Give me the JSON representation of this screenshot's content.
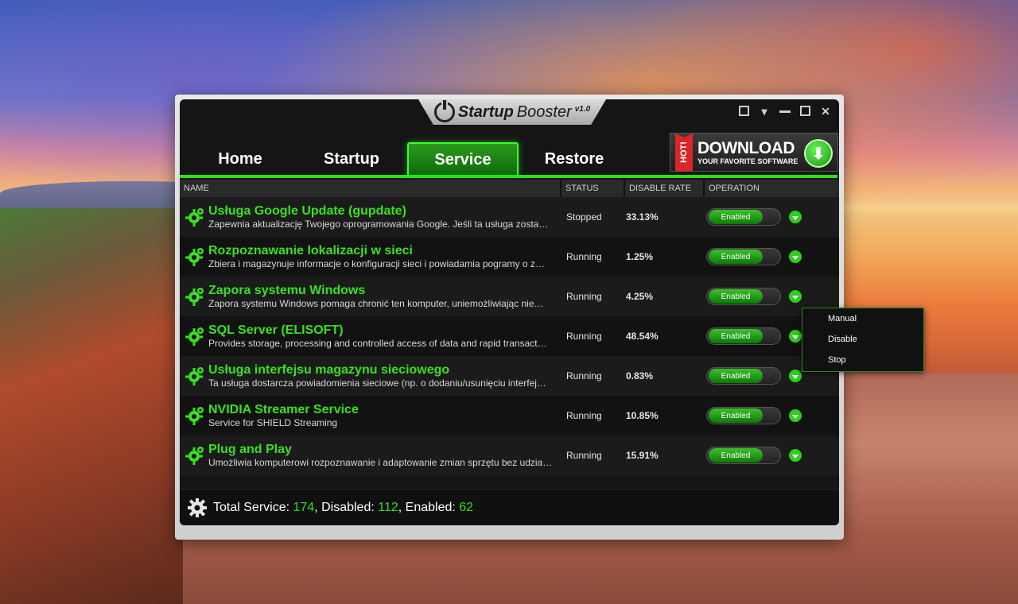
{
  "app": {
    "title_bold": "Startup",
    "title_light": "Booster",
    "version": "v1.0"
  },
  "nav": {
    "tabs": [
      {
        "label": "Home"
      },
      {
        "label": "Startup"
      },
      {
        "label": "Service"
      },
      {
        "label": "Restore"
      }
    ],
    "active": "Service"
  },
  "banner": {
    "hot": "HOT!",
    "main": "DOWNLOAD",
    "sub": "YOUR FAVORITE SOFTWARE"
  },
  "table": {
    "headers": {
      "name": "NAME",
      "status": "STATUS",
      "rate": "DISABLE RATE",
      "operation": "OPERATION"
    },
    "rows": [
      {
        "title": "Usługa Google Update (gupdate)",
        "desc": "Zapewnia aktualizację Twojego oprogramowania Google. Jeśli ta usługa zosta…",
        "status": "Stopped",
        "rate": "33.13%",
        "op": "Enabled"
      },
      {
        "title": "Rozpoznawanie lokalizacji w sieci",
        "desc": "Zbiera i magazynuje informacje o konfiguracji sieci i powiadamia pogramy o z…",
        "status": "Running",
        "rate": "1.25%",
        "op": "Enabled"
      },
      {
        "title": "Zapora systemu Windows",
        "desc": "Zapora systemu Windows pomaga chronić ten komputer, uniemożliwiając nie…",
        "status": "Running",
        "rate": "4.25%",
        "op": "Enabled"
      },
      {
        "title": "SQL Server (ELISOFT)",
        "desc": "Provides storage, processing and controlled access of data and rapid transact…",
        "status": "Running",
        "rate": "48.54%",
        "op": "Enabled"
      },
      {
        "title": "Usługa interfejsu magazynu sieciowego",
        "desc": "Ta usługa dostarcza powiadomienia sieciowe (np. o dodaniu/usunięciu interfej…",
        "status": "Running",
        "rate": "0.83%",
        "op": "Enabled"
      },
      {
        "title": "NVIDIA Streamer Service",
        "desc": "Service for SHIELD Streaming",
        "status": "Running",
        "rate": "10.85%",
        "op": "Enabled"
      },
      {
        "title": "Plug and Play",
        "desc": "Umożliwia komputerowi rozpoznawanie i adaptowanie zmian sprzętu bez udzia…",
        "status": "Running",
        "rate": "15.91%",
        "op": "Enabled"
      }
    ]
  },
  "footer": {
    "total_label": "Total Service:",
    "total": "174",
    "disabled_label": "Disabled:",
    "disabled": "112",
    "enabled_label": "Enabled:",
    "enabled": "62"
  },
  "context_menu": {
    "items": [
      "Manual",
      "Disable",
      "Stop"
    ]
  },
  "colors": {
    "accent": "#2ee01b",
    "title_green": "#39e020"
  }
}
